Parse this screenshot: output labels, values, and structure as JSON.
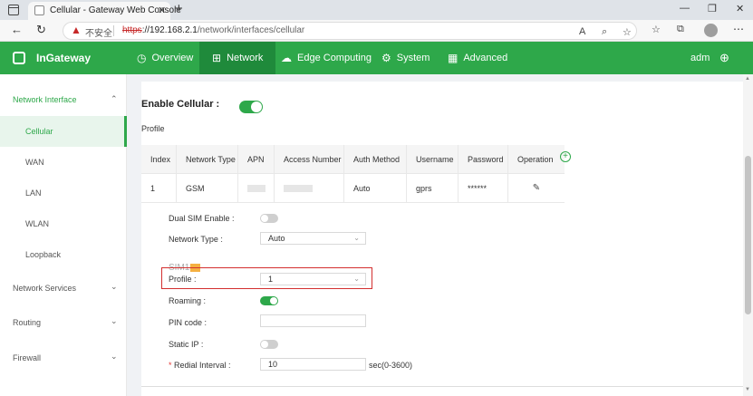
{
  "browser": {
    "tab_title": "Cellular - Gateway Web Console",
    "tab_close": "✕",
    "new_tab": "+",
    "insecure_label": "不安全",
    "url_scheme": "https",
    "url_rest": "://192.168.2.1",
    "url_path": "/network/interfaces/cellular"
  },
  "header": {
    "logo_text": "InGateway",
    "nav": [
      {
        "label": "Overview",
        "icon": "dashboard-icon"
      },
      {
        "label": "Network",
        "icon": "network-icon"
      },
      {
        "label": "Edge Computing",
        "icon": "cloud-icon"
      },
      {
        "label": "System",
        "icon": "gear-icon"
      },
      {
        "label": "Advanced",
        "icon": "grid-icon"
      }
    ],
    "user": "adm"
  },
  "sidebar": {
    "groups": [
      {
        "label": "Network Interface",
        "expanded": true
      },
      {
        "label": "Network Services",
        "expanded": false
      },
      {
        "label": "Routing",
        "expanded": false
      },
      {
        "label": "Firewall",
        "expanded": false
      }
    ],
    "items": [
      "Cellular",
      "WAN",
      "LAN",
      "WLAN",
      "Loopback"
    ]
  },
  "main": {
    "enable_label": "Enable Cellular :",
    "enable_on": true,
    "profile_title": "Profile",
    "table": {
      "headers": [
        "Index",
        "Network Type",
        "APN",
        "Access Number",
        "Auth Method",
        "Username",
        "Password",
        "Operation"
      ],
      "rows": [
        {
          "index": "1",
          "network_type": "GSM",
          "auth_method": "Auto",
          "username": "gprs",
          "password": "******"
        }
      ]
    },
    "dual_sim_label": "Dual SIM Enable :",
    "network_type_label": "Network Type :",
    "network_type_value": "Auto",
    "sim_title": "SIM1",
    "profile_label": "Profile :",
    "profile_value": "1",
    "roaming_label": "Roaming :",
    "pin_label": "PIN code :",
    "static_ip_label": "Static IP :",
    "redial_label": "Redial Interval :",
    "redial_value": "10",
    "redial_unit": "sec(0-3600)"
  },
  "colors": {
    "accent": "#2ea84a",
    "highlight": "#d32f2f"
  }
}
